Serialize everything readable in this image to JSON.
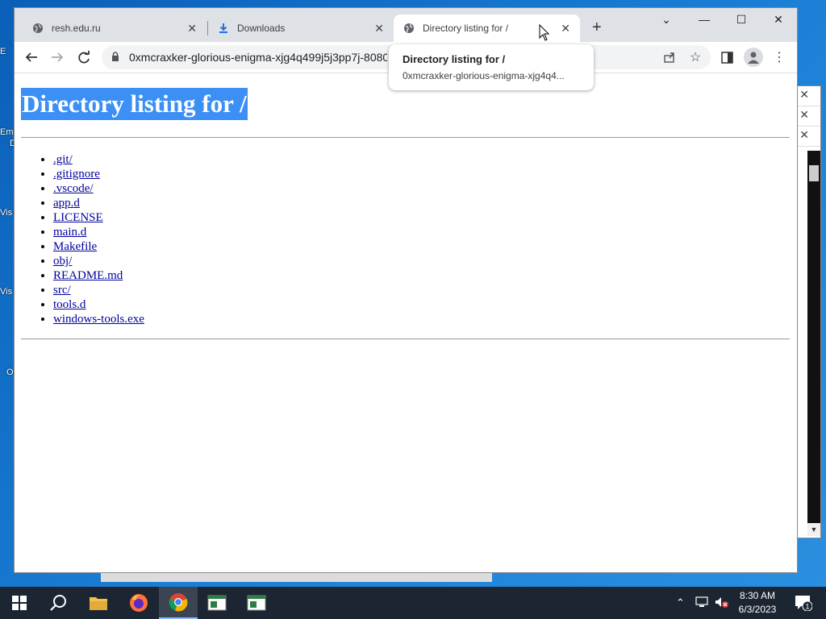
{
  "browser": {
    "tabs": [
      {
        "title": "resh.edu.ru",
        "icon": "globe-icon"
      },
      {
        "title": "Downloads",
        "icon": "download-icon"
      },
      {
        "title": "Directory listing for /",
        "icon": "globe-icon"
      }
    ],
    "url": "0xmcraxker-glorious-enigma-xjg4q499j5j3pp7j-8080",
    "tooltip": {
      "title": "Directory listing for /",
      "url": "0xmcraxker-glorious-enigma-xjg4q4..."
    }
  },
  "page": {
    "heading": "Directory listing for /",
    "files": [
      ".git/",
      ".gitignore",
      ".vscode/",
      "app.d",
      "LICENSE",
      "main.d",
      "Makefile",
      "obj/",
      "README.md",
      "src/",
      "tools.d",
      "windows-tools.exe"
    ]
  },
  "desktop": {
    "icon_labels": [
      "E",
      "Em",
      "D",
      "Vis",
      "Vis",
      "O"
    ]
  },
  "taskbar": {
    "time": "8:30 AM",
    "date": "6/3/2023",
    "notification_count": "1"
  },
  "colors": {
    "selection": "#3b8ff5",
    "link": "#00009e",
    "taskbar": "#1c2532"
  }
}
